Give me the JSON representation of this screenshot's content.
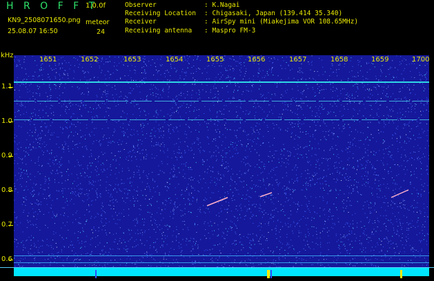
{
  "app": {
    "title": "H R O F F T",
    "version": "1.0.0f"
  },
  "file": {
    "name": "KN9_2508071650.png",
    "date_time": "25.08.07 16:50"
  },
  "counter": {
    "label": "meteor",
    "value": "24"
  },
  "station": [
    {
      "key": "Observer",
      "value": ": K.Nagai"
    },
    {
      "key": "Receiving Location",
      "value": ": Chigasaki, Japan (139.414 35.340)"
    },
    {
      "key": "Receiver",
      "value": ": AirSpy mini (Miakejima VOR 108.65MHz)"
    },
    {
      "key": "Receiving antenna",
      "value": ": Maspro FM-3"
    }
  ],
  "axes": {
    "y_unit": "kHz",
    "y_ticks": [
      "1.1",
      "1.0",
      "0.9",
      "0.8",
      "0.7",
      "0.6"
    ],
    "x_ticks": [
      "1651",
      "1652",
      "1653",
      "1654",
      "1655",
      "1656",
      "1657",
      "1658",
      "1659",
      "1700"
    ]
  },
  "colors": {
    "background": "#15189a",
    "text": "#e8e800",
    "brand": "#2ee06a",
    "signal": "#00e5ff"
  }
}
